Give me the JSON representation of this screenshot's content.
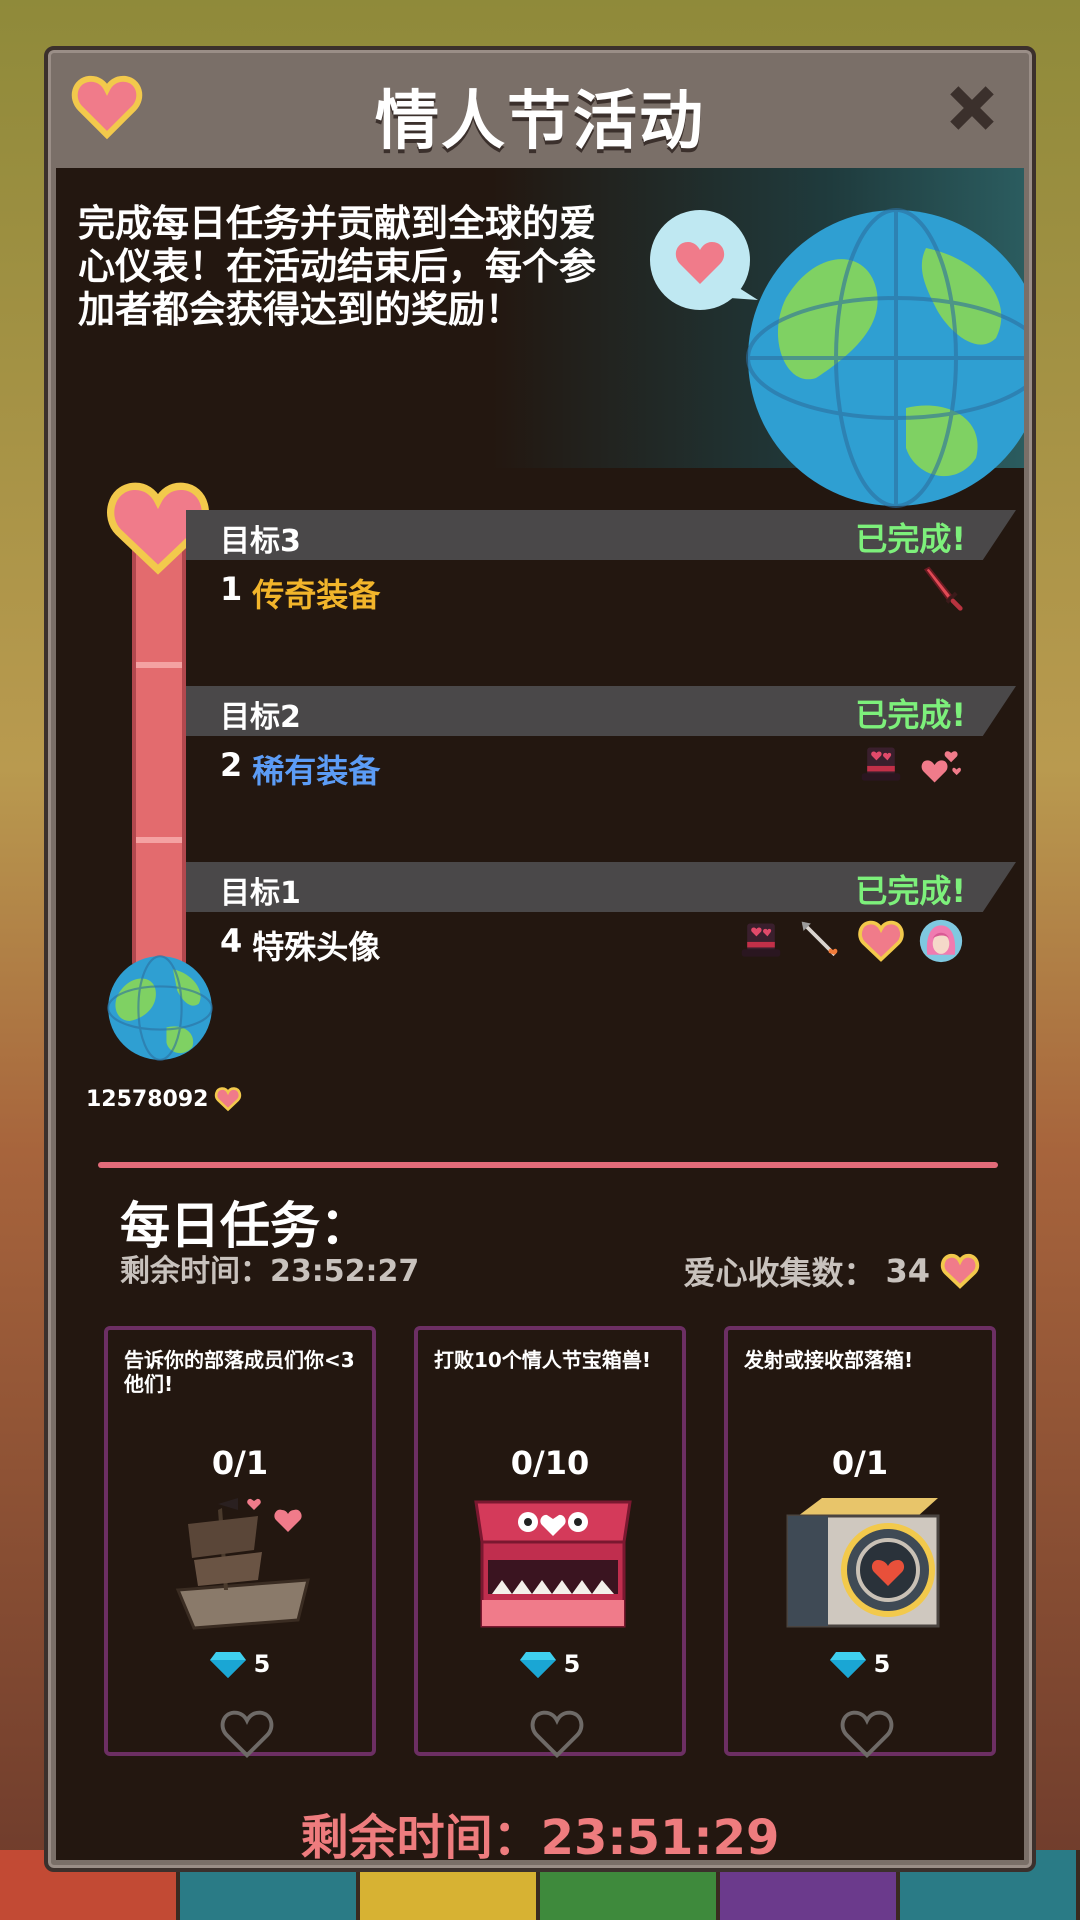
{
  "window": {
    "title": "情人节活动"
  },
  "intro": {
    "text": "完成每日任务并贡献到全球的爱心仪表！在活动结束后，每个参加者都会获得达到的奖励！"
  },
  "meter": {
    "global_hearts": "12578092"
  },
  "goals": [
    {
      "label": "目标3",
      "status": "已完成!",
      "reward_count": "1",
      "reward_name": "传奇装备",
      "reward_tier": "legendary",
      "icons": [
        "red-sword-icon"
      ]
    },
    {
      "label": "目标2",
      "status": "已完成!",
      "reward_count": "2",
      "reward_name": "稀有装备",
      "reward_tier": "rare",
      "icons": [
        "heart-top-hat-icon",
        "floating-hearts-icon"
      ]
    },
    {
      "label": "目标1",
      "status": "已完成!",
      "reward_count": "4",
      "reward_name": "特殊头像",
      "reward_tier": "special",
      "icons": [
        "heart-top-hat-icon",
        "cupid-arrow-icon",
        "heart-icon",
        "pink-hair-avatar-icon"
      ]
    }
  ],
  "daily": {
    "title": "每日任务：",
    "timer_label": "剩余时间：",
    "timer_value": "23:52:27",
    "hearts_label": "爱心收集数：",
    "hearts_value": "34"
  },
  "tasks": [
    {
      "description": "告诉你的部落成员们你<3他们!",
      "progress": "0/1",
      "reward": "5",
      "art": "pirate-ship-hearts-icon"
    },
    {
      "description": "打败10个情人节宝箱兽!",
      "progress": "0/10",
      "reward": "5",
      "art": "valentine-chest-monster-icon"
    },
    {
      "description": "发射或接收部落箱!",
      "progress": "0/1",
      "reward": "5",
      "art": "clan-crate-icon"
    }
  ],
  "footer": {
    "timer_label": "剩余时间：",
    "timer_value": "23:51:29"
  },
  "colors": {
    "heart_pink": "#f07b8a",
    "heart_outline": "#f2c94c",
    "completed_green": "#7df07b",
    "legendary_orange": "#f2b52b",
    "rare_blue": "#5c9cf5",
    "timer_red": "#ee7c7e",
    "task_border": "#6c2f63"
  }
}
